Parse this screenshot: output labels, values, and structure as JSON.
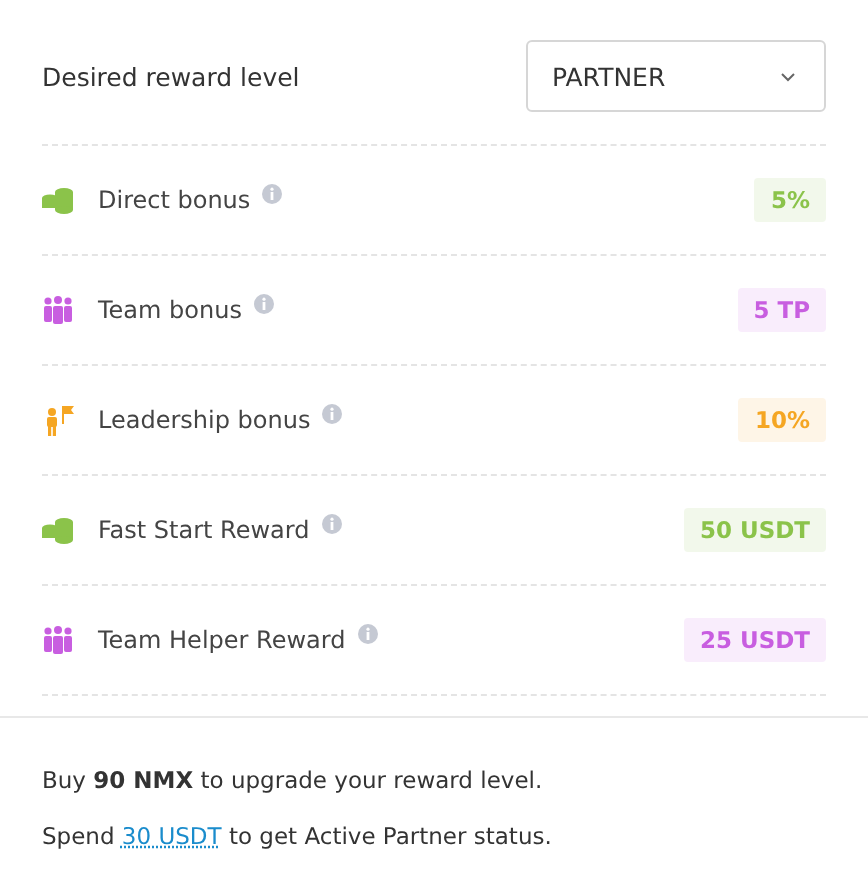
{
  "header": {
    "label": "Desired reward level",
    "select": {
      "value": "PARTNER"
    }
  },
  "rewards": [
    {
      "kind": "coins",
      "name": "Direct bonus",
      "value": "5%",
      "color": "#8bc34a"
    },
    {
      "kind": "team",
      "name": "Team bonus",
      "value": "5 TP",
      "color": "#c85ee0"
    },
    {
      "kind": "leader",
      "name": "Leadership bonus",
      "value": "10%",
      "color": "#f5a623"
    },
    {
      "kind": "coins",
      "name": "Fast Start Reward",
      "value": "50 USDT",
      "color": "#8bc34a"
    },
    {
      "kind": "team",
      "name": "Team Helper Reward",
      "value": "25 USDT",
      "color": "#c85ee0"
    }
  ],
  "upgrade_note": "Buy **90 NMX** to upgrade your reward level.",
  "status_note": {
    "before": "Spend",
    "link": "30 USDT",
    "after": "to get Active Partner status."
  }
}
